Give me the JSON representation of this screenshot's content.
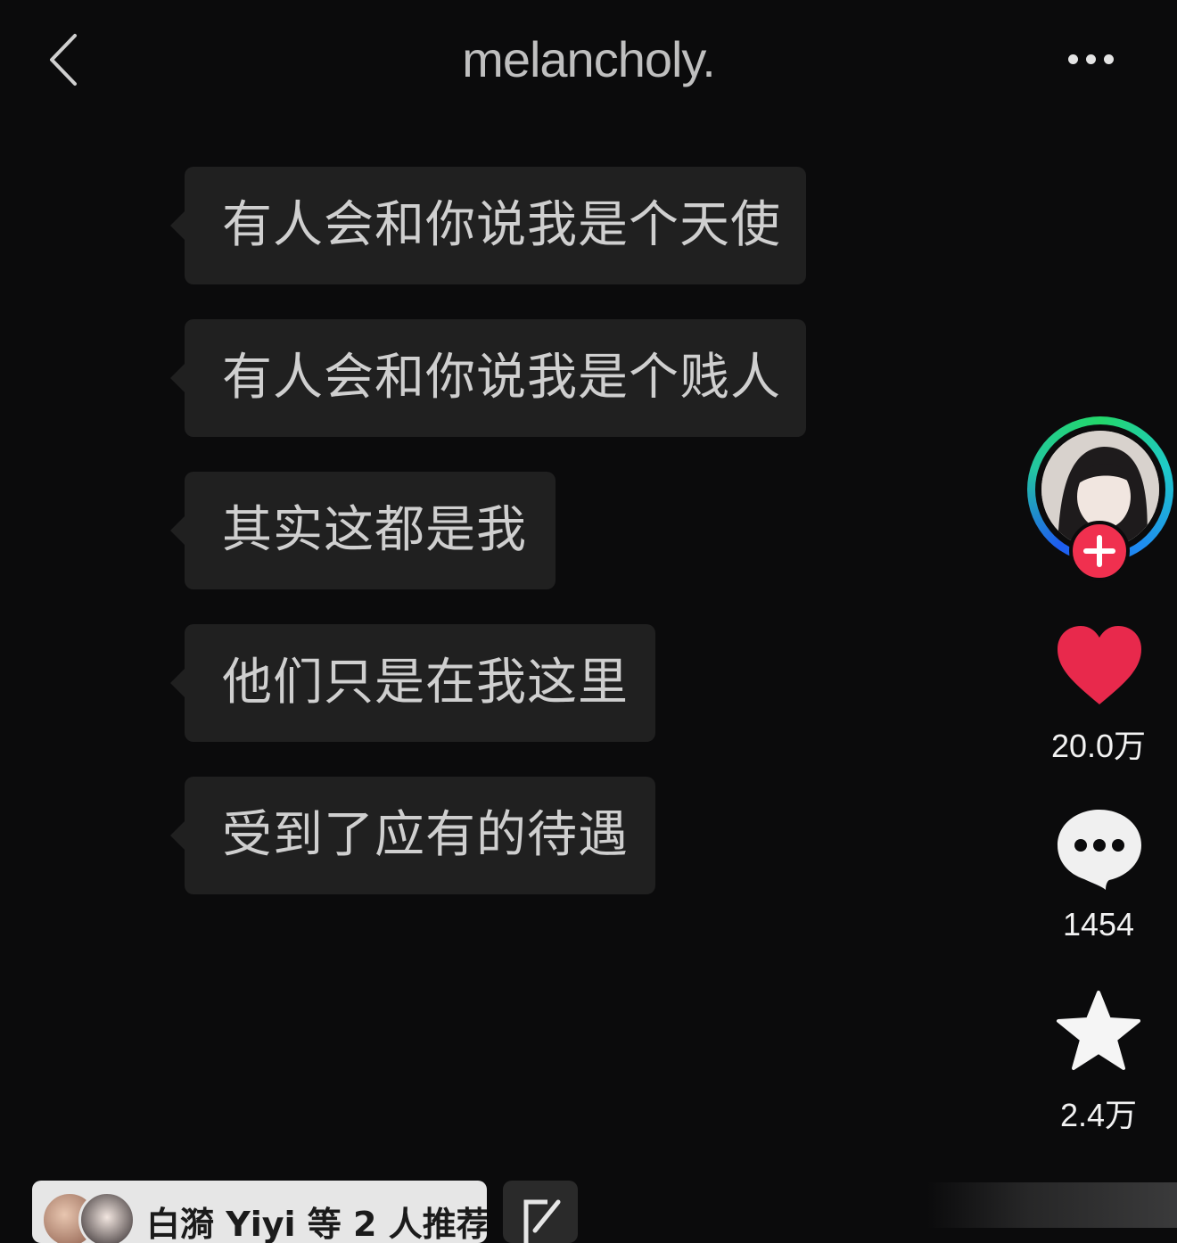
{
  "header": {
    "title": "melancholy.",
    "back_icon": "chevron-left-icon",
    "more_icon": "more-horizontal-icon"
  },
  "messages": [
    "有人会和你说我是个天使",
    "有人会和你说我是个贱人",
    "其实这都是我",
    "他们只是在我这里",
    "受到了应有的待遇"
  ],
  "sidebar": {
    "avatar_icon": "profile-avatar",
    "follow_icon": "plus-icon",
    "like_count": "20.0万",
    "comment_count": "1454",
    "favorite_count": "2.4万",
    "colors": {
      "like": "#e8294c",
      "follow": "#f0304f",
      "ring_start": "#23d76a",
      "ring_end": "#1e5cf0"
    }
  },
  "recommend": {
    "text": "白漪 Yiyi 等 2 人推荐",
    "edit_icon": "edit-icon"
  }
}
